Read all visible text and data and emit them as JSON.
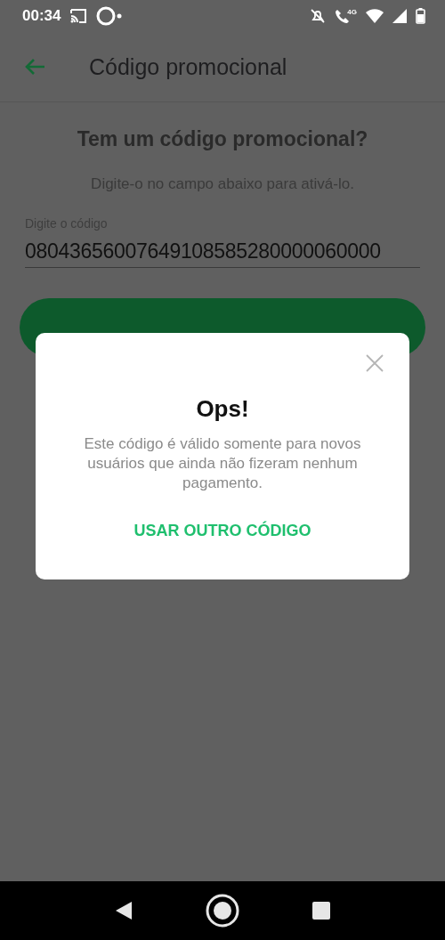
{
  "status_bar": {
    "time": "00:34",
    "network": "4G"
  },
  "app_bar": {
    "title": "Código promocional"
  },
  "content": {
    "heading": "Tem um código promocional?",
    "subtitle": "Digite-o no campo abaixo para ativá-lo.",
    "field": {
      "label": "Digite o código",
      "value": "08043656007649108585280000060000"
    }
  },
  "dialog": {
    "title": "Ops!",
    "message": "Este código é válido somente para novos usuários que ainda não fizeram nenhum pagamento.",
    "action": "USAR OUTRO CÓDIGO"
  }
}
